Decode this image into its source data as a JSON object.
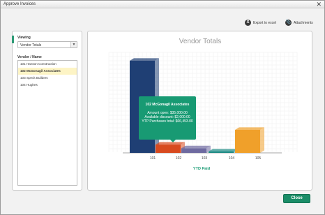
{
  "window": {
    "title": "Approve Invoices",
    "close_glyph": "✕"
  },
  "toolbar": {
    "export_label": "Export to excel",
    "export_icon": "excel-icon",
    "attach_label": "Attachments",
    "attach_icon": "paperclip-icon"
  },
  "sidebar": {
    "viewing_label": "Viewing",
    "viewing_value": "Vendor Totals",
    "vendor_label": "Vendor / Name",
    "vendors": [
      {
        "label": "101 Hanson Construction",
        "selected": false
      },
      {
        "label": "102 McGonagil Associates",
        "selected": true
      },
      {
        "label": "103 Speck Builders",
        "selected": false
      },
      {
        "label": "104 Hughes",
        "selected": false
      }
    ]
  },
  "chart_data": {
    "type": "bar",
    "title": "Vendor Totals",
    "xlabel": "YTD Paid",
    "ylabel": "",
    "categories": [
      "101",
      "102",
      "103",
      "104",
      "105"
    ],
    "values": [
      100,
      9,
      5,
      1,
      25
    ],
    "ylim": [
      0,
      100
    ],
    "colors": [
      "#1f3f74",
      "#d84a1f",
      "#6e6aa0",
      "#1d8a84",
      "#f0a02a"
    ],
    "grid": true
  },
  "tooltip": {
    "title": "102 McGonagil Associates",
    "lines": [
      "Amount open: $35,000.00",
      "Available discount: $2,000.00",
      "YTP Purchases total: $66,453.00"
    ]
  },
  "footer": {
    "close_label": "Close"
  },
  "colors": {
    "accent": "#189a73",
    "close_button": "#1b8d68"
  }
}
